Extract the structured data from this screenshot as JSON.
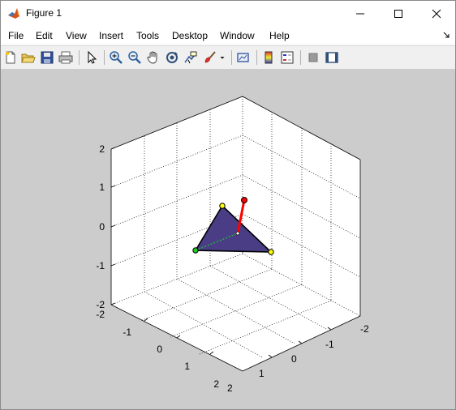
{
  "window": {
    "title": "Figure 1",
    "controls": [
      "minimize-icon",
      "maximize-icon",
      "close-icon"
    ]
  },
  "menu": {
    "items": [
      "File",
      "Edit",
      "View",
      "Insert",
      "Tools",
      "Desktop",
      "Window",
      "Help"
    ]
  },
  "toolbar": {
    "buttons": [
      "new-figure-icon",
      "open-file-icon",
      "save-icon",
      "print-icon",
      "edit-plot-arrow-icon",
      "zoom-in-icon",
      "zoom-out-icon",
      "pan-hand-icon",
      "rotate-3d-icon",
      "data-cursor-icon",
      "brush-icon",
      "brush-dropdown-icon",
      "link-plot-icon",
      "insert-colorbar-icon",
      "insert-legend-icon",
      "hide-plot-tools-icon",
      "show-plot-tools-icon"
    ]
  },
  "axes": {
    "z_ticks": [
      "2",
      "1",
      "0",
      "-1",
      "-2"
    ],
    "x_ticks": [
      "-2",
      "-1",
      "0",
      "1",
      "2"
    ],
    "y_ticks": [
      "-2",
      "-1",
      "0",
      "1",
      "2"
    ],
    "grid": "dotted",
    "box": true,
    "view": "isometric 3-D",
    "colors": {
      "background": "#cccccc",
      "axes_face": "#ffffff",
      "patch_fill": "#4a3d86",
      "red_segment": "#ff0000",
      "green_dotted": "#22aa44"
    }
  }
}
